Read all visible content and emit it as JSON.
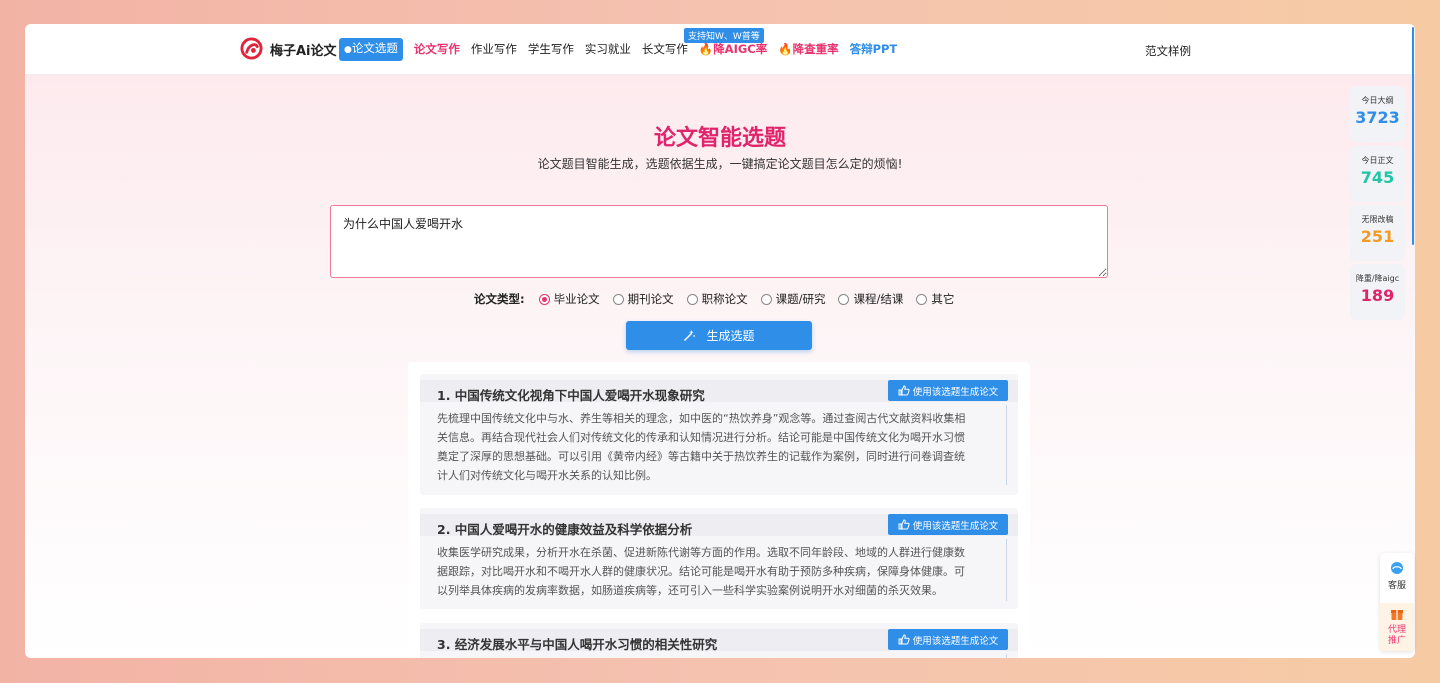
{
  "header": {
    "brand": "梅子Ai论文",
    "nav": [
      {
        "label": "论文选题",
        "style": "active"
      },
      {
        "label": "论文写作",
        "style": "pink"
      },
      {
        "label": "作业写作",
        "style": "normal"
      },
      {
        "label": "学生写作",
        "style": "normal"
      },
      {
        "label": "实习就业",
        "style": "normal"
      },
      {
        "label": "长文写作",
        "style": "normal"
      },
      {
        "label": "降AIGC率",
        "style": "red",
        "icon": "flame-icon"
      },
      {
        "label": "降查重率",
        "style": "red",
        "icon": "flame-icon"
      },
      {
        "label": "答辩PPT",
        "style": "blue"
      }
    ],
    "tip_badge": "支持知W、W普等",
    "samples": "范文样例"
  },
  "main": {
    "title": "论文智能选题",
    "subtitle": "论文题目智能生成，选题依据生成，一键搞定论文题目怎么定的烦恼!",
    "topic_value": "为什么中国人爱喝开水",
    "type_label": "论文类型:",
    "types": [
      {
        "label": "毕业论文",
        "checked": true
      },
      {
        "label": "期刊论文",
        "checked": false
      },
      {
        "label": "职称论文",
        "checked": false
      },
      {
        "label": "课题/研究",
        "checked": false
      },
      {
        "label": "课程/结课",
        "checked": false
      },
      {
        "label": "其它",
        "checked": false
      }
    ],
    "generate_label": "生成选题"
  },
  "results": [
    {
      "title": "1. 中国传统文化视角下中国人爱喝开水现象研究",
      "use_label": "使用该选题生成论文",
      "body": [
        "先梳理中国传统文化中与水、养生等相关的理念，如中医的“热饮养身”观念等。通过查阅古代文献资料收集相",
        "关信息。再结合现代社会人们对传统文化的传承和认知情况进行分析。结论可能是中国传统文化为喝开水习惯",
        "奠定了深厚的思想基础。可以引用《黄帝内经》等古籍中关于热饮养生的记载作为案例，同时进行问卷调查统",
        "计人们对传统文化与喝开水关系的认知比例。"
      ]
    },
    {
      "title": "2. 中国人爱喝开水的健康效益及科学依据分析",
      "use_label": "使用该选题生成论文",
      "body": [
        "收集医学研究成果，分析开水在杀菌、促进新陈代谢等方面的作用。选取不同年龄段、地域的人群进行健康数",
        "据跟踪，对比喝开水和不喝开水人群的健康状况。结论可能是喝开水有助于预防多种疾病，保障身体健康。可",
        "以列举具体疾病的发病率数据，如肠道疾病等，还可引入一些科学实验案例说明开水对细菌的杀灭效果。"
      ]
    },
    {
      "title": "3. 经济发展水平与中国人喝开水习惯的相关性研究",
      "use_label": "使用该选题生成论文",
      "body": []
    }
  ],
  "stats": [
    {
      "label": "今日大纲",
      "value": "3723",
      "color": "#2f8ee8"
    },
    {
      "label": "今日正文",
      "value": "745",
      "color": "#1fc6a6"
    },
    {
      "label": "无限改稿",
      "value": "251",
      "color": "#f59a23"
    },
    {
      "label": "降重/降aigc",
      "value": "189",
      "color": "#e0246b"
    }
  ],
  "side_widget": {
    "service": "客服",
    "promo_line1": "代理",
    "promo_line2": "推广"
  }
}
